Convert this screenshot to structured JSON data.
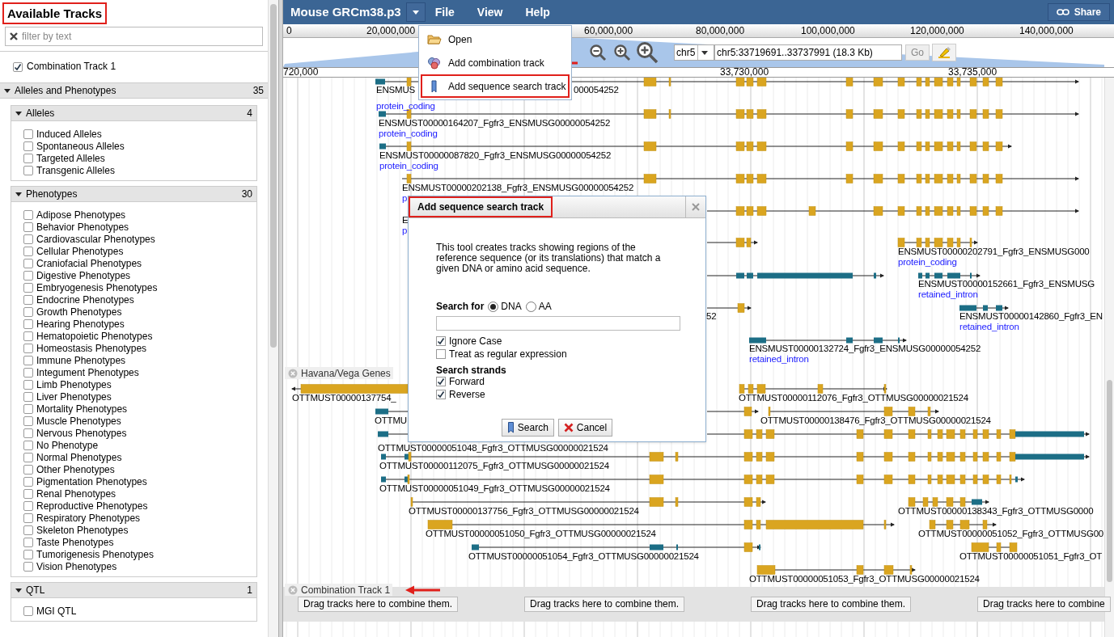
{
  "sidebar": {
    "title": "Available Tracks",
    "callout": true,
    "filter": {
      "placeholder": "filter by text"
    },
    "tracks": [
      {
        "label": "Combination Track 1",
        "checked": true
      }
    ],
    "categories": [
      {
        "title": "Alleles and Phenotypes",
        "count": "35",
        "expanded": true,
        "children": [
          {
            "title": "Alleles",
            "count": "4",
            "expanded": true,
            "tracks": [
              {
                "label": "Induced Alleles",
                "checked": false
              },
              {
                "label": "Spontaneous Alleles",
                "checked": false
              },
              {
                "label": "Targeted Alleles",
                "checked": false
              },
              {
                "label": "Transgenic Alleles",
                "checked": false
              }
            ]
          },
          {
            "title": "Phenotypes",
            "count": "30",
            "expanded": true,
            "tracks": [
              {
                "label": "Adipose Phenotypes",
                "checked": false
              },
              {
                "label": "Behavior Phenotypes",
                "checked": false
              },
              {
                "label": "Cardiovascular Phenotypes",
                "checked": false
              },
              {
                "label": "Cellular Phenotypes",
                "checked": false
              },
              {
                "label": "Craniofacial Phenotypes",
                "checked": false
              },
              {
                "label": "Digestive Phenotypes",
                "checked": false
              },
              {
                "label": "Embryogenesis Phenotypes",
                "checked": false
              },
              {
                "label": "Endocrine Phenotypes",
                "checked": false
              },
              {
                "label": "Growth Phenotypes",
                "checked": false
              },
              {
                "label": "Hearing Phenotypes",
                "checked": false
              },
              {
                "label": "Hematopoietic Phenotypes",
                "checked": false
              },
              {
                "label": "Homeostasis Phenotypes",
                "checked": false
              },
              {
                "label": "Immune Phenotypes",
                "checked": false
              },
              {
                "label": "Integument Phenotypes",
                "checked": false
              },
              {
                "label": "Limb Phenotypes",
                "checked": false
              },
              {
                "label": "Liver Phenotypes",
                "checked": false
              },
              {
                "label": "Mortality Phenotypes",
                "checked": false
              },
              {
                "label": "Muscle Phenotypes",
                "checked": false
              },
              {
                "label": "Nervous Phenotypes",
                "checked": false
              },
              {
                "label": "No Phenotype",
                "checked": false
              },
              {
                "label": "Normal Phenotypes",
                "checked": false
              },
              {
                "label": "Other Phenotypes",
                "checked": false
              },
              {
                "label": "Pigmentation Phenotypes",
                "checked": false
              },
              {
                "label": "Renal Phenotypes",
                "checked": false
              },
              {
                "label": "Reproductive Phenotypes",
                "checked": false
              },
              {
                "label": "Respiratory Phenotypes",
                "checked": false
              },
              {
                "label": "Skeleton Phenotypes",
                "checked": false
              },
              {
                "label": "Taste Phenotypes",
                "checked": false
              },
              {
                "label": "Tumorigenesis Phenotypes",
                "checked": false
              },
              {
                "label": "Vision Phenotypes",
                "checked": false
              }
            ]
          },
          {
            "title": "QTL",
            "count": "1",
            "expanded": true,
            "tracks": [
              {
                "label": "MGI QTL",
                "checked": false
              }
            ]
          }
        ]
      }
    ]
  },
  "header": {
    "title": "Mouse GRCm38.p3",
    "menus": [
      "File",
      "View",
      "Help"
    ],
    "share": "Share"
  },
  "file_menu": {
    "items": [
      {
        "label": "Open",
        "kind": "open",
        "arrow": false,
        "callout": false
      },
      {
        "label": "Add combination track",
        "kind": "combination",
        "arrow": true,
        "callout": false
      },
      {
        "label": "Add sequence search track",
        "kind": "sequence",
        "arrow": false,
        "callout": true
      }
    ]
  },
  "overview": {
    "ticks": [
      "0",
      "20,000,000",
      "60,000,000",
      "80,000,000",
      "100,000,000",
      "120,000,000",
      "140,000,000"
    ]
  },
  "navigation": {
    "chromosome": "chr5",
    "location": "chr5:33719691..33737991 (18.3 Kb)",
    "go": "Go"
  },
  "ruler": {
    "ticks": [
      "720,000",
      "33,730,000",
      "33,735,000"
    ]
  },
  "tracks": [
    {
      "kind": "genes",
      "features": [
        {
          "name": "ENSMUS",
          "type": "protein_coding"
        },
        {
          "name": "000054252"
        },
        {
          "name": "ENSMUST00000164207_Fgfr3_ENSMUSG00000054252",
          "type": "protein_coding"
        },
        {
          "name": "ENSMUST00000087820_Fgfr3_ENSMUSG00000054252",
          "type": "protein_coding"
        },
        {
          "name": "ENSMUST00000202138_Fgfr3_ENSMUSG00000054252",
          "type": "p"
        },
        {
          "name": "E",
          "type": "p"
        },
        {
          "name": "ENSMUST00000202791_Fgfr3_ENSMUSG000",
          "type": "protein_coding"
        },
        {
          "name": "ENSMUST00000152661_Fgfr3_ENSMUSG",
          "type": "retained_intron"
        },
        {
          "name": "52"
        },
        {
          "name": "ENSMUST00000142860_Fgfr3_EN",
          "type": "retained_intron"
        },
        {
          "name": "ENSMUST00000132724_Fgfr3_ENSMUSG00000054252",
          "type": "retained_intron"
        }
      ]
    },
    {
      "kind": "genes",
      "title": "Havana/Vega Genes",
      "features": [
        {
          "name": "OTTMUST00000137754_"
        },
        {
          "name": "OTTMUST00000112076_Fgfr3_OTTMUSG00000021524"
        },
        {
          "name": "OTTMU"
        },
        {
          "name": "OTTMUST00000138476_Fgfr3_OTTMUSG00000021524"
        },
        {
          "name": "OTTMUST00000051048_Fgfr3_OTTMUSG00000021524"
        },
        {
          "name": "OTTMUST00000112075_Fgfr3_OTTMUSG00000021524"
        },
        {
          "name": "OTTMUST00000051049_Fgfr3_OTTMUSG00000021524"
        },
        {
          "name": "OTTMUST00000137756_Fgfr3_OTTMUSG00000021524"
        },
        {
          "name": "OTTMUST00000138343_Fgfr3_OTTMUSG0000"
        },
        {
          "name": "OTTMUST00000051050_Fgfr3_OTTMUSG00000021524"
        },
        {
          "name": "OTTMUST00000051052_Fgfr3_OTTMUSG00"
        },
        {
          "name": "OTTMUST00000051054_Fgfr3_OTTMUSG00000021524"
        },
        {
          "name": "OTTMUST00000051051_Fgfr3_OT"
        },
        {
          "name": "OTTMUST00000051053_Fgfr3_OTTMUSG00000021524"
        }
      ]
    },
    {
      "kind": "combination",
      "title": "Combination Track 1",
      "arrow": true,
      "drop_zones": [
        "Drag tracks here to combine them.",
        "Drag tracks here to combine them.",
        "Drag tracks here to combine them.",
        "Drag tracks here to combine"
      ]
    }
  ],
  "dialog": {
    "title": "Add sequence search track",
    "callout": true,
    "description": "This tool creates tracks showing regions of the reference sequence (or its translations) that match a given DNA or amino acid sequence.",
    "search_for": {
      "label": "Search for",
      "options": [
        {
          "label": "DNA",
          "selected": true
        },
        {
          "label": "AA",
          "selected": false
        }
      ]
    },
    "options": [
      {
        "label": "Ignore Case",
        "checked": true
      },
      {
        "label": "Treat as regular expression",
        "checked": false
      }
    ],
    "strands": {
      "label": "Search strands",
      "options": [
        {
          "label": "Forward",
          "checked": true
        },
        {
          "label": "Reverse",
          "checked": true
        }
      ]
    },
    "buttons": [
      {
        "label": "Search",
        "kind": "search"
      },
      {
        "label": "Cancel",
        "kind": "cancel"
      }
    ]
  }
}
